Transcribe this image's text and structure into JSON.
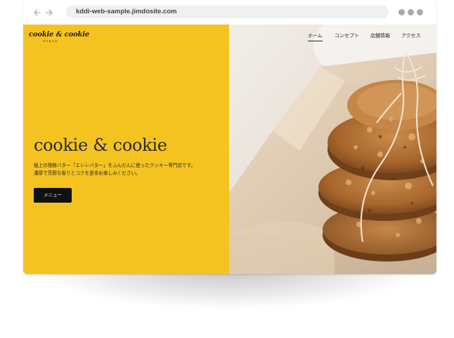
{
  "browser": {
    "url": "kddi-web-sample.jimdosite.com",
    "back_icon": "arrow-left-icon",
    "forward_icon": "arrow-right-icon",
    "menu_icon": "three-dots-icon"
  },
  "site": {
    "logo": "cookie & cookie",
    "logo_sub": "TOKYO",
    "nav": [
      "ホーム",
      "コンセプト",
      "店舗情報",
      "アクセス"
    ],
    "active_nav": "ホーム"
  },
  "hero": {
    "title": "cookie & cookie",
    "lead_line1": "極上の発酵バター「エシレバター」をふんだんに使ったクッキー専門店です。",
    "lead_line2": "濃厚で芳醇な香りとコクを是非お楽しみください。",
    "button_label": "メニュー",
    "image": "cookies-tied-with-twine-photo"
  },
  "colors": {
    "hero_yellow": "#f4c320",
    "button_bg": "#111111",
    "text_dark": "#2b2b2b"
  }
}
